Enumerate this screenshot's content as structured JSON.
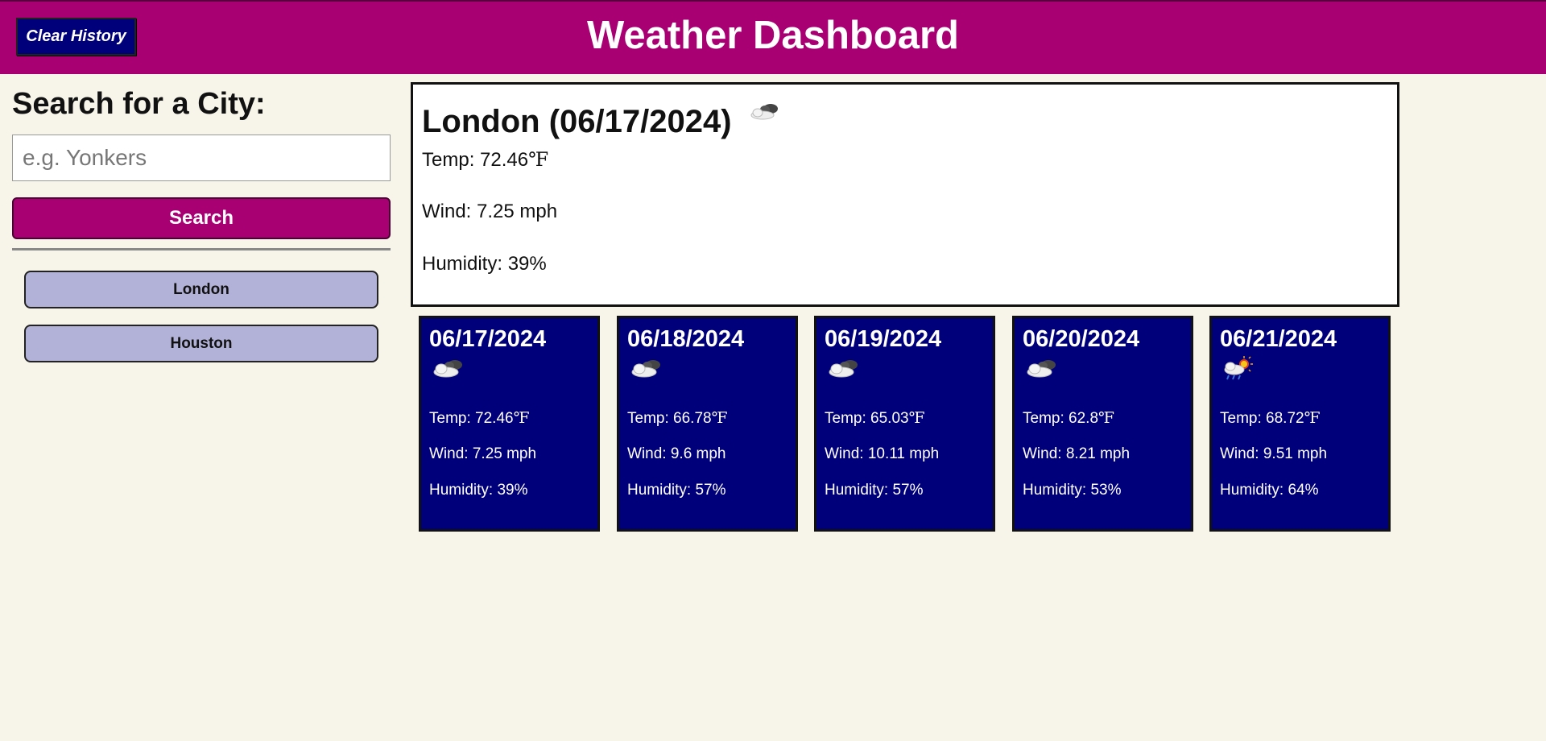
{
  "header": {
    "clear_history_label": "Clear History",
    "title": "Weather Dashboard"
  },
  "sidebar": {
    "heading": "Search for a City:",
    "search_placeholder": "e.g. Yonkers",
    "search_value": "",
    "search_button_label": "Search",
    "history": [
      {
        "label": "London"
      },
      {
        "label": "Houston"
      }
    ]
  },
  "current": {
    "title": "London (06/17/2024)",
    "icon": "cloud-icon",
    "temp_label": "Temp: ",
    "temp_value": "72.46",
    "temp_unit": "℉",
    "wind": "Wind: 7.25 mph",
    "humidity": "Humidity: 39%"
  },
  "forecast": [
    {
      "date": "06/17/2024",
      "icon": "cloud-icon",
      "temp_label": "Temp: ",
      "temp_value": "72.46",
      "temp_unit": "℉",
      "wind": "Wind: 7.25 mph",
      "humidity": "Humidity: 39%"
    },
    {
      "date": "06/18/2024",
      "icon": "cloud-icon",
      "temp_label": "Temp: ",
      "temp_value": "66.78",
      "temp_unit": "℉",
      "wind": "Wind: 9.6 mph",
      "humidity": "Humidity: 57%"
    },
    {
      "date": "06/19/2024",
      "icon": "cloud-icon",
      "temp_label": "Temp: ",
      "temp_value": "65.03",
      "temp_unit": "℉",
      "wind": "Wind: 10.11 mph",
      "humidity": "Humidity: 57%"
    },
    {
      "date": "06/20/2024",
      "icon": "cloud-icon",
      "temp_label": "Temp: ",
      "temp_value": "62.8",
      "temp_unit": "℉",
      "wind": "Wind: 8.21 mph",
      "humidity": "Humidity: 53%"
    },
    {
      "date": "06/21/2024",
      "icon": "rain-sun-cloud-icon",
      "temp_label": "Temp: ",
      "temp_value": "68.72",
      "temp_unit": "℉",
      "wind": "Wind: 9.51 mph",
      "humidity": "Humidity: 64%"
    }
  ],
  "colors": {
    "header_bg": "#a80073",
    "card_bg": "#00007a",
    "history_bg": "#b2b2d8",
    "page_bg": "#f7f5e9"
  }
}
